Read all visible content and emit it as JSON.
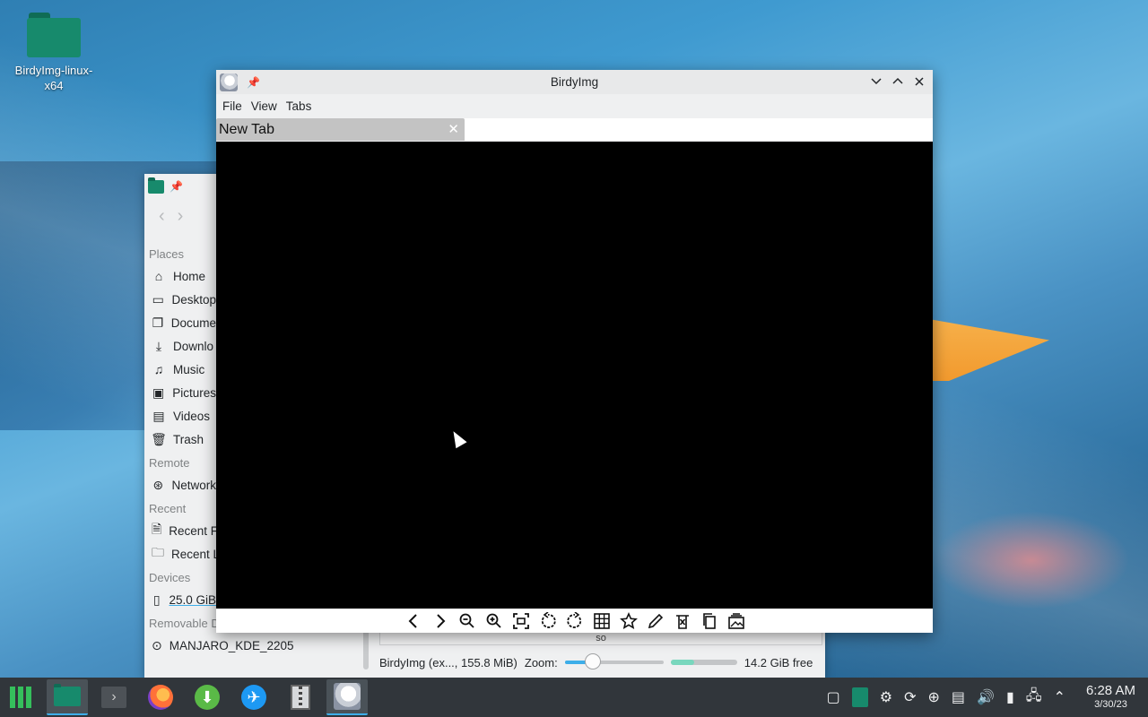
{
  "desktop": {
    "icon_label": "BirdyImg-linux-x64"
  },
  "file_manager": {
    "sections": {
      "places": "Places",
      "remote": "Remote",
      "recent": "Recent",
      "devices": "Devices",
      "removable": "Removable Devices"
    },
    "places": [
      {
        "label": "Home",
        "icon": "home-icon"
      },
      {
        "label": "Desktop",
        "icon": "desktop-icon"
      },
      {
        "label": "Docume",
        "icon": "documents-icon"
      },
      {
        "label": "Downlo",
        "icon": "downloads-icon"
      },
      {
        "label": "Music",
        "icon": "music-icon"
      },
      {
        "label": "Pictures",
        "icon": "pictures-icon"
      },
      {
        "label": "Videos",
        "icon": "videos-icon"
      },
      {
        "label": "Trash",
        "icon": "trash-icon"
      }
    ],
    "remote": [
      {
        "label": "Network",
        "icon": "network-icon"
      }
    ],
    "recent": [
      {
        "label": "Recent F",
        "icon": "recent-files-icon"
      },
      {
        "label": "Recent L",
        "icon": "recent-locations-icon"
      }
    ],
    "devices": [
      {
        "label": "25.0 GiB",
        "icon": "drive-icon"
      }
    ],
    "removable": [
      {
        "label": "MANJARO_KDE_2205",
        "icon": "usb-drive-icon"
      }
    ],
    "scroll_label": "so",
    "status": {
      "selection": "BirdyImg (ex..., 155.8 MiB)",
      "zoom_label": "Zoom:",
      "free": "14.2 GiB free"
    }
  },
  "birdy": {
    "title": "BirdyImg",
    "menu": [
      "File",
      "View",
      "Tabs"
    ],
    "tab_label": "New Tab",
    "toolbar": [
      "previous-icon",
      "next-icon",
      "zoom-out-icon",
      "zoom-in-icon",
      "fit-screen-icon",
      "rotate-left-icon",
      "rotate-right-icon",
      "grid-icon",
      "star-icon",
      "edit-icon",
      "delete-icon",
      "copy-icon",
      "gallery-icon"
    ]
  },
  "taskbar": {
    "time": "6:28 AM",
    "date": "3/30/23"
  },
  "colors": {
    "accent": "#3daee9",
    "panel": "#31363b",
    "window": "#eff0f1",
    "folder": "#178a6c"
  }
}
